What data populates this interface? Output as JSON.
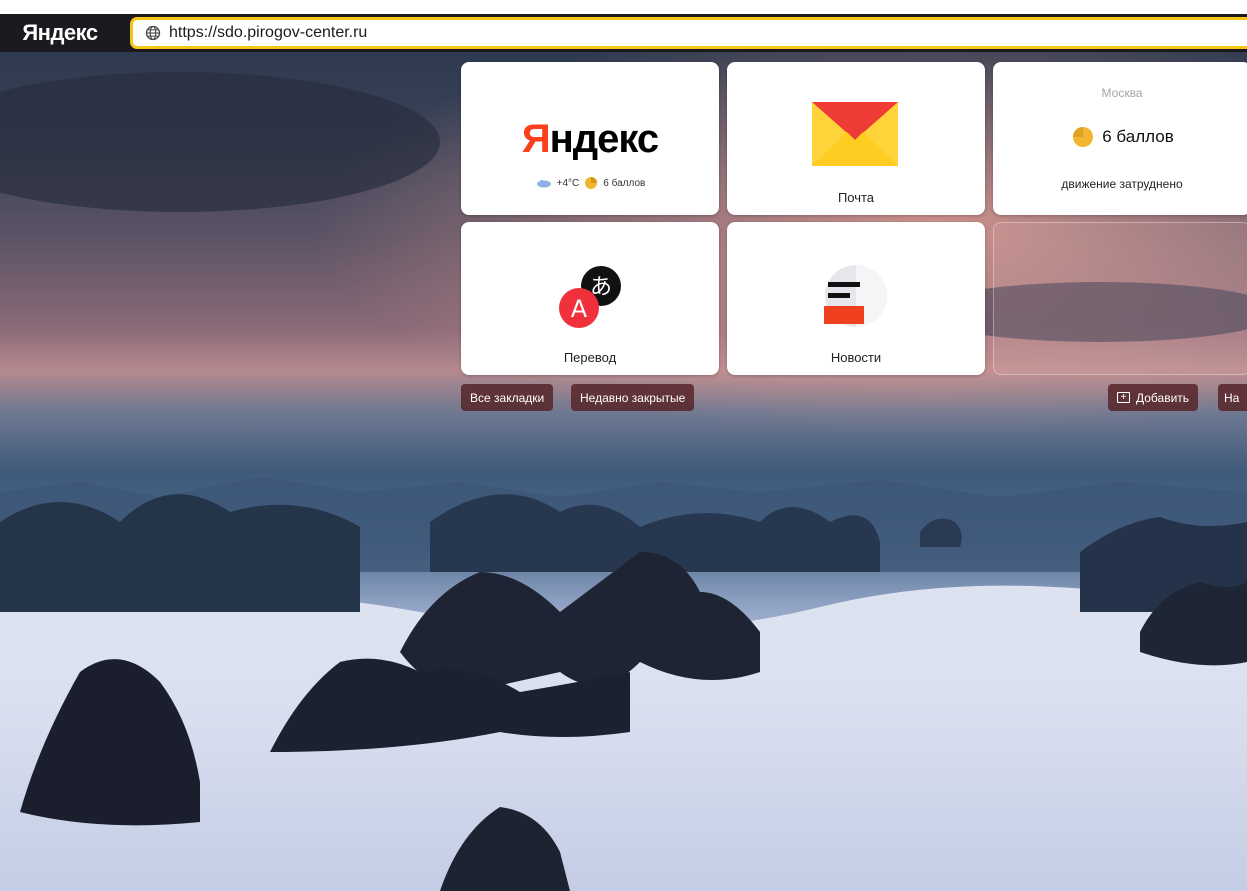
{
  "browser": {
    "brand": "Яндекс",
    "url": "https://sdo.pirogov-center.ru"
  },
  "tiles": {
    "yandex": {
      "logo_first": "Я",
      "logo_rest": "ндекс",
      "weather": "+4°C",
      "traffic": "6 баллов"
    },
    "mail": {
      "label": "Почта"
    },
    "traffic": {
      "city": "Москва",
      "score": "6 баллов",
      "status": "движение затруднено"
    },
    "translate": {
      "label": "Перевод"
    },
    "news": {
      "label": "Новости"
    }
  },
  "actions": {
    "bookmarks": "Все закладки",
    "recently_closed": "Недавно закрытые",
    "add": "Добавить",
    "more": "На"
  },
  "colors": {
    "brand_red": "#fc3f1d",
    "address_border": "#f5c518",
    "pill_bg": "#58282c",
    "traffic_yellow": "#f2b530"
  },
  "icons": {
    "address": "globe-icon",
    "weather": "cloud-icon",
    "traffic": "traffic-jam-icon",
    "mail": "envelope-icon",
    "translate": "translate-icon",
    "news": "news-icon",
    "add": "plus-box-icon"
  }
}
